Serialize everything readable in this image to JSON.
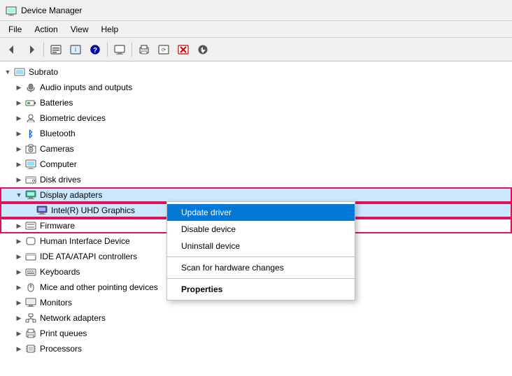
{
  "titleBar": {
    "title": "Device Manager",
    "icon": "⚙"
  },
  "menuBar": {
    "items": [
      "File",
      "Action",
      "View",
      "Help"
    ]
  },
  "toolbar": {
    "buttons": [
      "◀",
      "▶",
      "🖥",
      "📋",
      "❓",
      "⊞",
      "🖨",
      "🖥",
      "🔍",
      "✖",
      "⬇"
    ]
  },
  "tree": {
    "root": "Subrato",
    "items": [
      {
        "label": "Audio inputs and outputs",
        "indent": 1,
        "icon": "audio",
        "expanded": false
      },
      {
        "label": "Batteries",
        "indent": 1,
        "icon": "battery",
        "expanded": false
      },
      {
        "label": "Biometric devices",
        "indent": 1,
        "icon": "fingerprint",
        "expanded": false
      },
      {
        "label": "Bluetooth",
        "indent": 1,
        "icon": "bluetooth",
        "expanded": false
      },
      {
        "label": "Cameras",
        "indent": 1,
        "icon": "camera",
        "expanded": false
      },
      {
        "label": "Computer",
        "indent": 1,
        "icon": "computer",
        "expanded": false
      },
      {
        "label": "Disk drives",
        "indent": 1,
        "icon": "disk",
        "expanded": false
      },
      {
        "label": "Display adapters",
        "indent": 1,
        "icon": "display",
        "expanded": true,
        "highlighted": true
      },
      {
        "label": "Intel(R) UHD Graphics",
        "indent": 2,
        "icon": "display-small",
        "selected": true,
        "highlighted": true
      },
      {
        "label": "Firmware",
        "indent": 1,
        "icon": "firmware",
        "expanded": false,
        "highlighted": true
      },
      {
        "label": "Human Interface Device",
        "indent": 1,
        "icon": "hid",
        "expanded": false
      },
      {
        "label": "IDE ATA/ATAPI controllers",
        "indent": 1,
        "icon": "ide",
        "expanded": false
      },
      {
        "label": "Keyboards",
        "indent": 1,
        "icon": "keyboard",
        "expanded": false
      },
      {
        "label": "Mice and other pointing devices",
        "indent": 1,
        "icon": "mouse",
        "expanded": false
      },
      {
        "label": "Monitors",
        "indent": 1,
        "icon": "monitor",
        "expanded": false
      },
      {
        "label": "Network adapters",
        "indent": 1,
        "icon": "network",
        "expanded": false
      },
      {
        "label": "Print queues",
        "indent": 1,
        "icon": "printer",
        "expanded": false
      },
      {
        "label": "Processors",
        "indent": 1,
        "icon": "processor",
        "expanded": false
      }
    ]
  },
  "contextMenu": {
    "items": [
      {
        "label": "Update driver",
        "active": true,
        "bold": false
      },
      {
        "label": "Disable device",
        "active": false
      },
      {
        "label": "Uninstall device",
        "active": false
      },
      {
        "sep": true
      },
      {
        "label": "Scan for hardware changes",
        "active": false
      },
      {
        "sep": true
      },
      {
        "label": "Properties",
        "active": false,
        "bold": true
      }
    ]
  }
}
